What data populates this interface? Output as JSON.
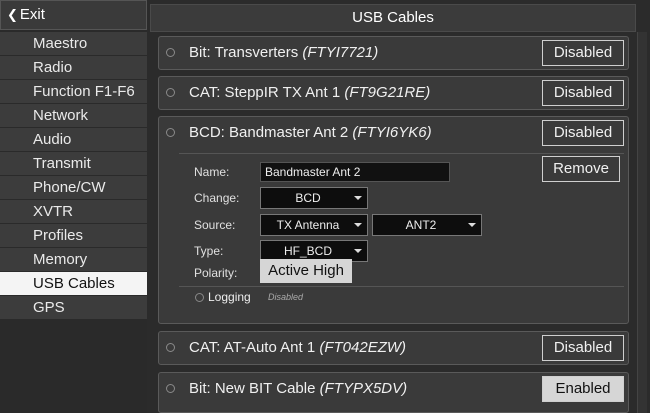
{
  "sidebar": {
    "exit_label": "Exit",
    "items": [
      {
        "label": "Maestro"
      },
      {
        "label": "Radio"
      },
      {
        "label": "Function F1-F6"
      },
      {
        "label": "Network"
      },
      {
        "label": "Audio"
      },
      {
        "label": "Transmit"
      },
      {
        "label": "Phone/CW"
      },
      {
        "label": "XVTR"
      },
      {
        "label": "Profiles"
      },
      {
        "label": "Memory"
      },
      {
        "label": "USB Cables",
        "selected": true
      },
      {
        "label": "GPS"
      }
    ]
  },
  "header": {
    "title": "USB Cables"
  },
  "cables": [
    {
      "name": "Bit: Transverters",
      "serial": "(FTYI7721)",
      "state": "Disabled"
    },
    {
      "name": "CAT: SteppIR TX Ant 1",
      "serial": "(FT9G21RE)",
      "state": "Disabled"
    },
    {
      "name": "BCD: Bandmaster Ant 2",
      "serial": "(FTYI6YK6)",
      "state": "Disabled"
    },
    {
      "name": "CAT: AT-Auto Ant 1",
      "serial": "(FT042EZW)",
      "state": "Disabled"
    },
    {
      "name": "Bit: New BIT Cable",
      "serial": "(FTYPX5DV)",
      "state": "Enabled"
    }
  ],
  "details": {
    "name_label": "Name:",
    "name_value": "Bandmaster Ant 2",
    "change_label": "Change:",
    "change_value": "BCD",
    "source_label": "Source:",
    "source_value": "TX Antenna",
    "antenna_value": "ANT2",
    "type_label": "Type:",
    "type_value": "HF_BCD",
    "polarity_label": "Polarity:",
    "polarity_value": "Active High",
    "remove_label": "Remove",
    "logging_label": "Logging",
    "logging_status": "Disabled"
  },
  "colors": {
    "selected_bg": "#f4f4f4",
    "enabled_bg": "#d6d6d6",
    "panel_bg": "#3a3a3a"
  }
}
